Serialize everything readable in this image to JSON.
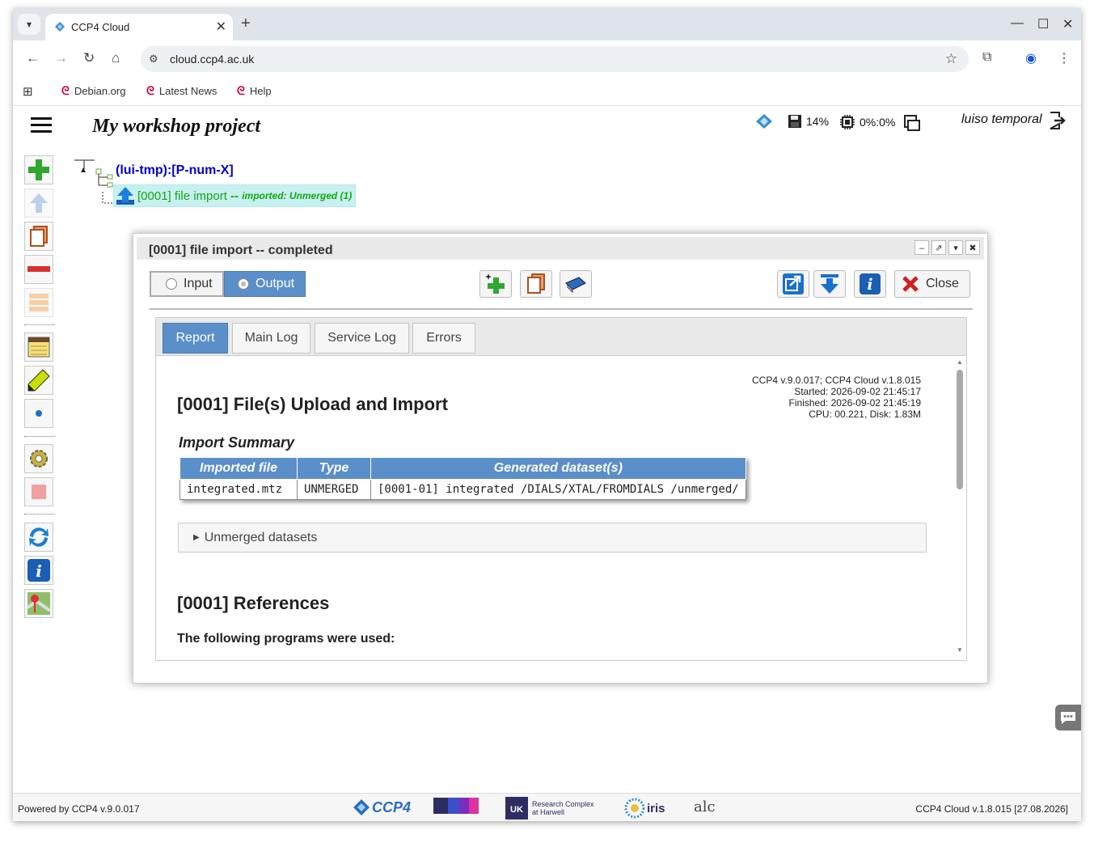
{
  "browser": {
    "tab_title": "CCP4 Cloud",
    "tab_close": "✕",
    "new_tab": "+",
    "url": "cloud.ccp4.ac.uk",
    "bookmarks": [
      "Debian.org",
      "Latest News",
      "Help"
    ]
  },
  "header": {
    "project_title": "My workshop project",
    "disk_usage": "14%",
    "cpu_usage": "0%:0%",
    "user": "luiso temporal"
  },
  "tree": {
    "root": "(lui-tmp):[P-num-X]",
    "job_label": "[0001] file import",
    "job_status": " -- ",
    "job_detail": "imported: Unmerged (1)"
  },
  "dialog": {
    "title": "[0001] file import -- completed",
    "toggle_input": "Input",
    "toggle_output": "Output",
    "close_label": "Close",
    "tabs": [
      "Report",
      "Main Log",
      "Service Log",
      "Errors"
    ]
  },
  "report": {
    "version_info": [
      "CCP4 v.9.0.017; CCP4 Cloud v.1.8.015",
      "Started: 2026-09-02 21:45:17",
      "Finished: 2026-09-02 21:45:19",
      "CPU: 00.221, Disk: 1.83M"
    ],
    "heading": "[0001] File(s) Upload and Import",
    "summary_title": "Import Summary",
    "table": {
      "headers": [
        "Imported file",
        "Type",
        "Generated dataset(s)"
      ],
      "rows": [
        [
          "integrated.mtz",
          "UNMERGED",
          "[0001-01] integrated /DIALS/XTAL/FROMDIALS /unmerged/"
        ]
      ]
    },
    "accordion": "Unmerged datasets",
    "references_heading": "[0001] References",
    "programs_text": "The following programs were used:"
  },
  "footer": {
    "left": "Powered by CCP4 v.9.0.017",
    "right": "CCP4 Cloud v.1.8.015 [27.08.2026]",
    "logos": [
      "CCP4",
      "Research Complex at Harwell",
      "iris",
      "alc"
    ]
  }
}
